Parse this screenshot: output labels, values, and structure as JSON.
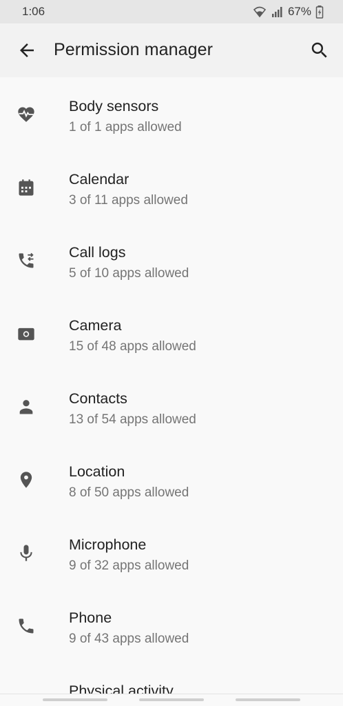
{
  "status_bar": {
    "time": "1:06",
    "battery": "67%"
  },
  "header": {
    "title": "Permission manager"
  },
  "permissions": [
    {
      "label": "Body sensors",
      "sub": "1 of 1 apps allowed",
      "icon": "heart-pulse-icon"
    },
    {
      "label": "Calendar",
      "sub": "3 of 11 apps allowed",
      "icon": "calendar-icon"
    },
    {
      "label": "Call logs",
      "sub": "5 of 10 apps allowed",
      "icon": "call-log-icon"
    },
    {
      "label": "Camera",
      "sub": "15 of 48 apps allowed",
      "icon": "camera-icon"
    },
    {
      "label": "Contacts",
      "sub": "13 of 54 apps allowed",
      "icon": "person-icon"
    },
    {
      "label": "Location",
      "sub": "8 of 50 apps allowed",
      "icon": "location-pin-icon"
    },
    {
      "label": "Microphone",
      "sub": "9 of 32 apps allowed",
      "icon": "microphone-icon"
    },
    {
      "label": "Phone",
      "sub": "9 of 43 apps allowed",
      "icon": "phone-icon"
    },
    {
      "label": "Physical activity",
      "sub": "",
      "icon": ""
    }
  ],
  "colors": {
    "icon": "#555555",
    "text_primary": "#222222",
    "text_secondary": "#757575"
  }
}
